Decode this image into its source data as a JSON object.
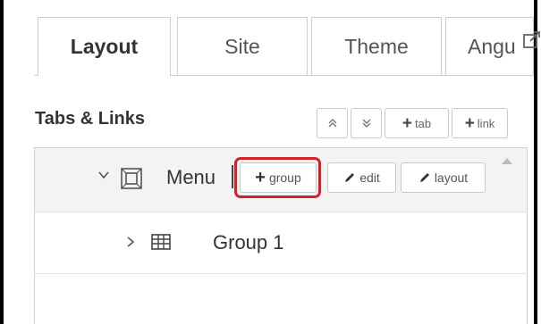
{
  "tabs": [
    {
      "label": "Layout",
      "active": true
    },
    {
      "label": "Site",
      "active": false
    },
    {
      "label": "Theme",
      "active": false
    },
    {
      "label": "Angu",
      "active": false
    }
  ],
  "section": {
    "title": "Tabs & Links",
    "buttons": {
      "collapse_icon": "chevrons-up-icon",
      "expand_icon": "chevrons-down-icon",
      "add_tab_label": "tab",
      "add_link_label": "link"
    }
  },
  "tree": {
    "menu": {
      "label": "Menu",
      "expanded": true,
      "add_group_label": "group",
      "edit_label": "edit",
      "layout_label": "layout"
    },
    "group": {
      "label": "Group 1",
      "expanded": false
    }
  },
  "colors": {
    "highlight": "#d6202a",
    "row_hover": "#f3f3f3"
  }
}
